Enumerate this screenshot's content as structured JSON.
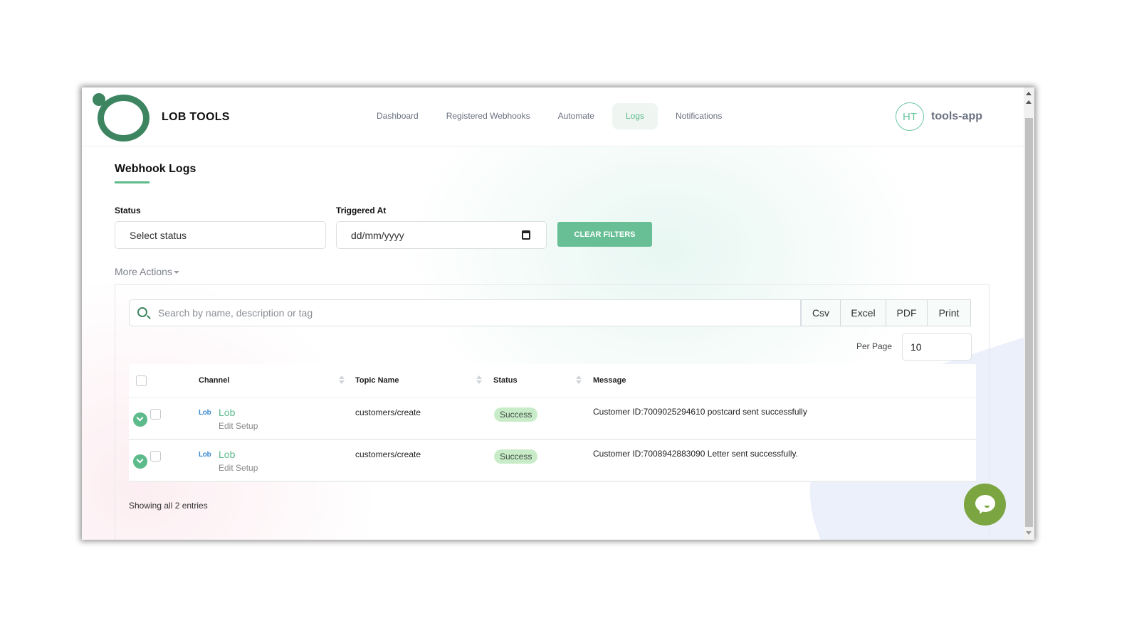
{
  "app": {
    "brand": "LOB TOOLS"
  },
  "nav": {
    "items": [
      {
        "label": "Dashboard",
        "active": false
      },
      {
        "label": "Registered Webhooks",
        "active": false
      },
      {
        "label": "Automate",
        "active": false
      },
      {
        "label": "Logs",
        "active": true
      },
      {
        "label": "Notifications",
        "active": false
      }
    ]
  },
  "user": {
    "initials": "HT",
    "name": "tools-app"
  },
  "page": {
    "title": "Webhook Logs"
  },
  "filters": {
    "status_label": "Status",
    "status_placeholder": "Select status",
    "triggered_label": "Triggered At",
    "triggered_placeholder": "dd/mm/yyyy",
    "clear_button": "CLEAR FILTERS"
  },
  "more_actions": "More Actions",
  "search": {
    "placeholder": "Search by name, description or tag"
  },
  "export": {
    "buttons": [
      "Csv",
      "Excel",
      "PDF",
      "Print"
    ]
  },
  "pagination": {
    "per_page_label": "Per Page",
    "per_page_value": "10",
    "summary": "Showing all 2 entries"
  },
  "table": {
    "columns": [
      "Channel",
      "Topic Name",
      "Status",
      "Message"
    ],
    "rows": [
      {
        "channel_logo": "Lob",
        "channel": "Lob",
        "action": "Edit Setup",
        "topic": "customers/create",
        "status": "Success",
        "message": "Customer ID:7009025294610 postcard sent successfully"
      },
      {
        "channel_logo": "Lob",
        "channel": "Lob",
        "action": "Edit Setup",
        "topic": "customers/create",
        "status": "Success",
        "message": "Customer ID:7008942883090 Letter sent successfully."
      }
    ]
  },
  "colors": {
    "accent": "#5dba8b",
    "brand_dark": "#3d8560",
    "success_badge": "#c8ecc8",
    "chat": "#7ba540"
  }
}
